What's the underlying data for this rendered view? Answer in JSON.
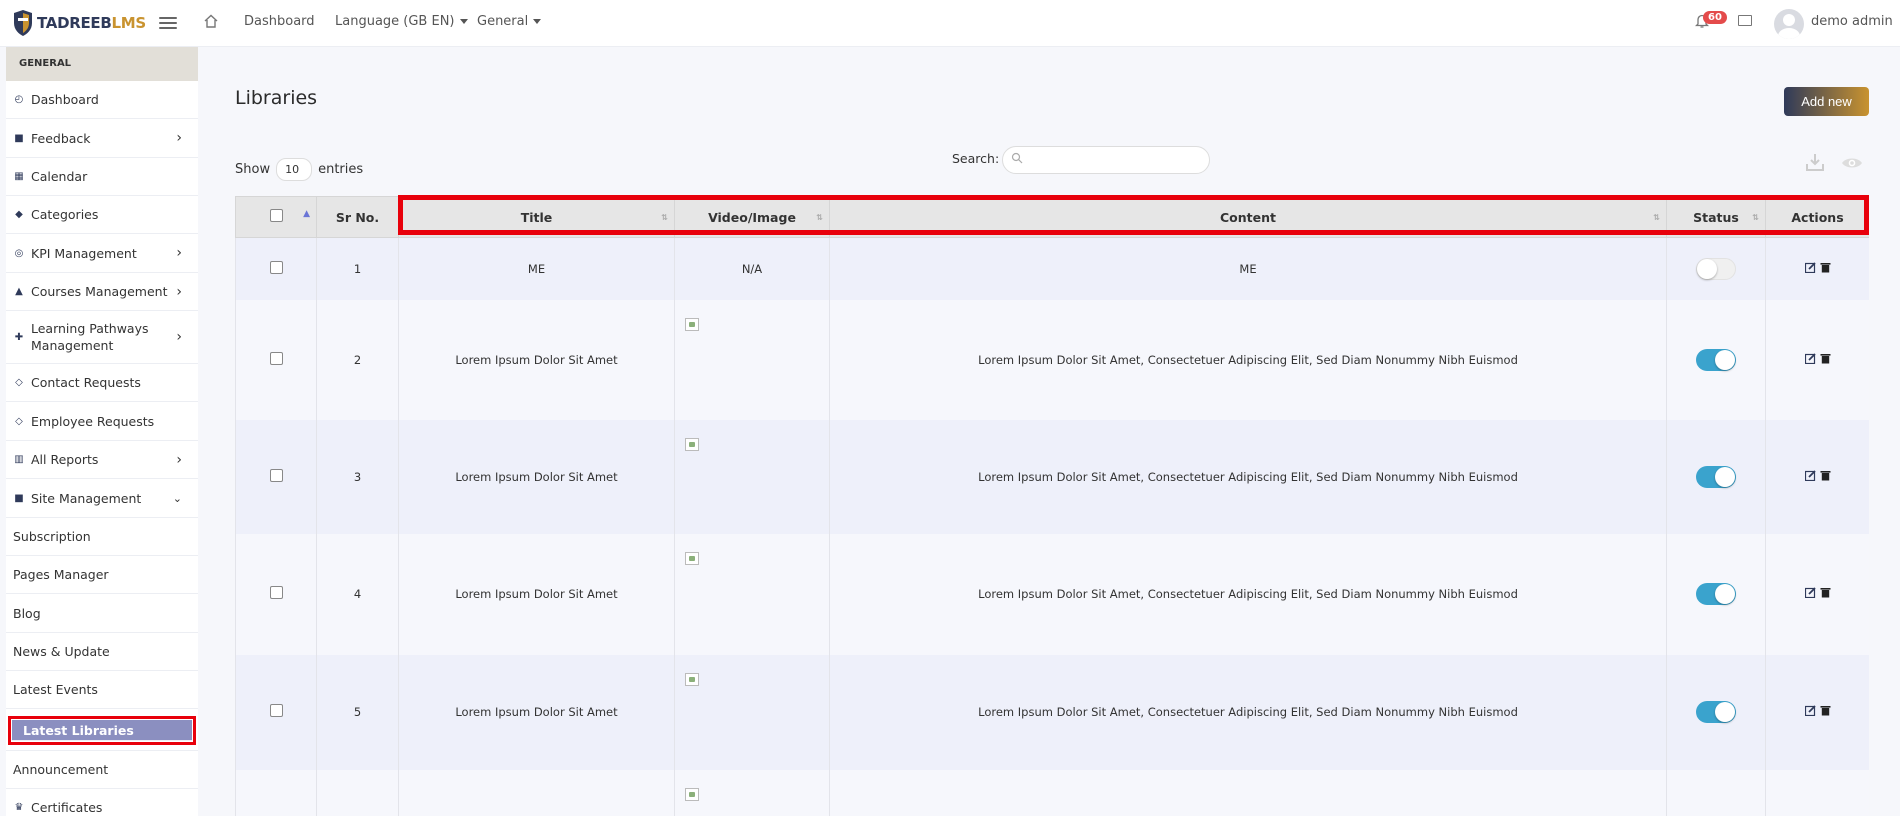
{
  "header": {
    "brand_part1": "TADREEB",
    "brand_part2": "LMS",
    "nav": [
      {
        "label": "Dashboard"
      },
      {
        "label": "Language (GB EN)"
      },
      {
        "label": "General"
      }
    ],
    "notification_count": "60",
    "user_name": "demo admin"
  },
  "sidebar": {
    "section": "GENERAL",
    "items": [
      {
        "label": "Dashboard",
        "icon": "gauge-icon"
      },
      {
        "label": "Feedback",
        "icon": "comments-icon",
        "expand": ">"
      },
      {
        "label": "Calendar",
        "icon": "calendar-icon"
      },
      {
        "label": "Categories",
        "icon": "tags-icon"
      },
      {
        "label": "KPI Management",
        "icon": "target-icon",
        "expand": ">"
      },
      {
        "label": "Courses Management",
        "icon": "graduation-cap-icon",
        "expand": ">"
      },
      {
        "label": "Learning Pathways Management",
        "icon": "puzzle-icon",
        "expand": ">"
      },
      {
        "label": "Contact Requests",
        "icon": "tag-icon"
      },
      {
        "label": "Employee Requests",
        "icon": "tag-icon"
      },
      {
        "label": "All Reports",
        "icon": "chart-icon",
        "expand": ">"
      },
      {
        "label": "Site Management",
        "icon": "folder-icon",
        "expand": "v"
      },
      {
        "label": "Subscription"
      },
      {
        "label": "Pages Manager"
      },
      {
        "label": "Blog"
      },
      {
        "label": "News & Update"
      },
      {
        "label": "Latest Events"
      },
      {
        "label": "Latest Libraries",
        "active": true
      },
      {
        "label": "Announcement"
      },
      {
        "label": "Certificates",
        "icon": "trophy-icon"
      }
    ]
  },
  "page": {
    "title": "Libraries",
    "add_button": "Add new",
    "show_label": "Show",
    "entries_value": "10",
    "entries_label": "entries",
    "search_label": "Search:",
    "search_placeholder": ""
  },
  "table": {
    "columns": [
      "Sr No.",
      "Title",
      "Video/Image",
      "Content",
      "Status",
      "Actions"
    ],
    "rows": [
      {
        "sr": "1",
        "title": "ME",
        "media": "N/A",
        "content": "ME",
        "status": "off"
      },
      {
        "sr": "2",
        "title": "Lorem Ipsum Dolor Sit Amet",
        "media": "image",
        "content": "Lorem Ipsum Dolor Sit Amet, Consectetuer Adipiscing Elit, Sed Diam Nonummy Nibh Euismod",
        "status": "on"
      },
      {
        "sr": "3",
        "title": "Lorem Ipsum Dolor Sit Amet",
        "media": "image",
        "content": "Lorem Ipsum Dolor Sit Amet, Consectetuer Adipiscing Elit, Sed Diam Nonummy Nibh Euismod",
        "status": "on"
      },
      {
        "sr": "4",
        "title": "Lorem Ipsum Dolor Sit Amet",
        "media": "image",
        "content": "Lorem Ipsum Dolor Sit Amet, Consectetuer Adipiscing Elit, Sed Diam Nonummy Nibh Euismod",
        "status": "on"
      },
      {
        "sr": "5",
        "title": "Lorem Ipsum Dolor Sit Amet",
        "media": "image",
        "content": "Lorem Ipsum Dolor Sit Amet, Consectetuer Adipiscing Elit, Sed Diam Nonummy Nibh Euismod",
        "status": "on"
      }
    ]
  },
  "colors": {
    "brand_dark": "#2f3a5a",
    "brand_gold": "#c9932f",
    "highlight_red": "#e8000b",
    "toggle_on": "#3aa3cd",
    "active_item": "#8b8fc0"
  }
}
